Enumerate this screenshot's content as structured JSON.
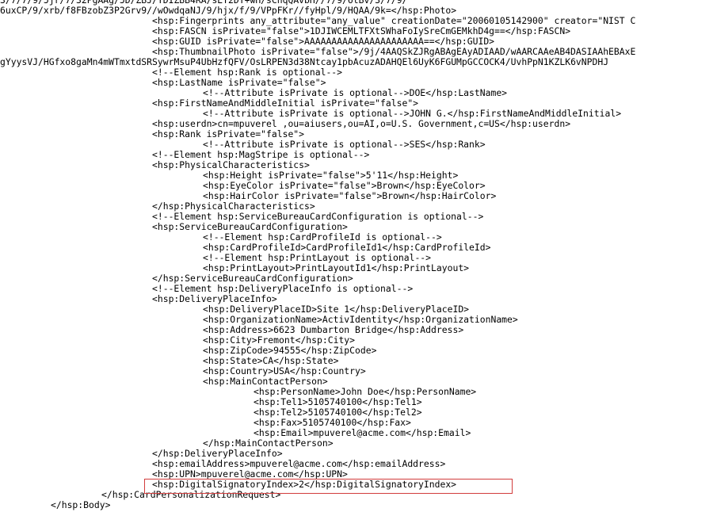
{
  "highlight_color": "#d23c3c",
  "lines": [
    {
      "indent": 0,
      "text": "3/7/7/9/5jr/7/32PgAAg/5D/ZBJ/YDIZBB4RA/sET2DT+wH/sChqQAvbH//7/9/6tBv/3/7/9/"
    },
    {
      "indent": 0,
      "text": "6uxCP/9/xrb/f8FBzobZ3P2Grv9//wOwdqaNJ/9/hjx/f/9/VPpFKr//fyHpl/9/HQAA/9k=</hsp:Photo>"
    },
    {
      "indent": 192,
      "text": "<hsp:Fingerprints any_attribute=\"any_value\" creationDate=\"20060105142900\" creator=\"NIST C"
    },
    {
      "indent": 192,
      "text": "<hsp:FASCN isPrivate=\"false\">1DJIWCEMLTFXtSWhaFoIySreCmGEMkhD4g==</hsp:FASCN>"
    },
    {
      "indent": 192,
      "text": "<hsp:GUID isPrivate=\"false\">AAAAAAAAAAAAAAAAAAAAAA==</hsp:GUID>"
    },
    {
      "indent": 192,
      "text": "<hsp:ThumbnailPhoto isPrivate=\"false\">/9j/4AAQSkZJRgABAgEAyADIAAD/wAARCAAeAB4DASIAAhEBAxE"
    },
    {
      "indent": 0,
      "text": "gYyysVJ/HGfxo8gaMn4mWTmxtdSRSywrMsuP4UbHzfQFV/OsLRPEN3d38Ntcay1pbAcuzADAHQEl6UyK6FGUMpGCCOCK4/UvhPpN1KZLK6vNPDHJ"
    },
    {
      "indent": 192,
      "text": "<!--Element hsp:Rank is optional-->"
    },
    {
      "indent": 192,
      "text": "<hsp:LastName isPrivate=\"false\">"
    },
    {
      "indent": 256,
      "text": "<!--Attribute isPrivate is optional-->DOE</hsp:LastName>"
    },
    {
      "indent": 192,
      "text": "<hsp:FirstNameAndMiddleInitial isPrivate=\"false\">"
    },
    {
      "indent": 256,
      "text": "<!--Attribute isPrivate is optional-->JOHN G.</hsp:FirstNameAndMiddleInitial>"
    },
    {
      "indent": 192,
      "text": "<hsp:userdn>cn=mpuverel ,ou=aiusers,ou=AI,o=U.S. Government,c=US</hsp:userdn>"
    },
    {
      "indent": 192,
      "text": "<hsp:Rank isPrivate=\"false\">"
    },
    {
      "indent": 256,
      "text": "<!--Attribute isPrivate is optional-->SES</hsp:Rank>"
    },
    {
      "indent": 192,
      "text": "<!--Element hsp:MagStripe is optional-->"
    },
    {
      "indent": 192,
      "text": "<hsp:PhysicalCharacteristics>"
    },
    {
      "indent": 256,
      "text": "<hsp:Height isPrivate=\"false\">5'11</hsp:Height>"
    },
    {
      "indent": 256,
      "text": "<hsp:EyeColor isPrivate=\"false\">Brown</hsp:EyeColor>"
    },
    {
      "indent": 256,
      "text": "<hsp:HairColor isPrivate=\"false\">Brown</hsp:HairColor>"
    },
    {
      "indent": 192,
      "text": "</hsp:PhysicalCharacteristics>"
    },
    {
      "indent": 192,
      "text": "<!--Element hsp:ServiceBureauCardConfiguration is optional-->"
    },
    {
      "indent": 192,
      "text": "<hsp:ServiceBureauCardConfiguration>"
    },
    {
      "indent": 256,
      "text": "<!--Element hsp:CardProfileId is optional-->"
    },
    {
      "indent": 256,
      "text": "<hsp:CardProfileId>CardProfileId1</hsp:CardProfileId>"
    },
    {
      "indent": 256,
      "text": "<!--Element hsp:PrintLayout is optional-->"
    },
    {
      "indent": 256,
      "text": "<hsp:PrintLayout>PrintLayoutId1</hsp:PrintLayout>"
    },
    {
      "indent": 192,
      "text": "</hsp:ServiceBureauCardConfiguration>"
    },
    {
      "indent": 192,
      "text": "<!--Element hsp:DeliveryPlaceInfo is optional-->"
    },
    {
      "indent": 192,
      "text": "<hsp:DeliveryPlaceInfo>"
    },
    {
      "indent": 256,
      "text": "<hsp:DeliveryPlaceID>Site 1</hsp:DeliveryPlaceID>"
    },
    {
      "indent": 256,
      "text": "<hsp:OrganizationName>ActivIdentity</hsp:OrganizationName>"
    },
    {
      "indent": 256,
      "text": "<hsp:Address>6623 Dumbarton Bridge</hsp:Address>"
    },
    {
      "indent": 256,
      "text": "<hsp:City>Fremont</hsp:City>"
    },
    {
      "indent": 256,
      "text": "<hsp:ZipCode>94555</hsp:ZipCode>"
    },
    {
      "indent": 256,
      "text": "<hsp:State>CA</hsp:State>"
    },
    {
      "indent": 256,
      "text": "<hsp:Country>USA</hsp:Country>"
    },
    {
      "indent": 256,
      "text": "<hsp:MainContactPerson>"
    },
    {
      "indent": 320,
      "text": "<hsp:PersonName>John Doe</hsp:PersonName>"
    },
    {
      "indent": 320,
      "text": "<hsp:Tel1>5105740100</hsp:Tel1>"
    },
    {
      "indent": 320,
      "text": "<hsp:Tel2>5105740100</hsp:Tel2>"
    },
    {
      "indent": 320,
      "text": "<hsp:Fax>5105740100</hsp:Fax>"
    },
    {
      "indent": 320,
      "text": "<hsp:Email>mpuverel@acme.com</hsp:Email>"
    },
    {
      "indent": 256,
      "text": "</hsp:MainContactPerson>"
    },
    {
      "indent": 192,
      "text": "</hsp:DeliveryPlaceInfo>"
    },
    {
      "indent": 192,
      "text": "<hsp:emailAddress>mpuverel@acme.com</hsp:emailAddress>"
    },
    {
      "indent": 192,
      "text": "<hsp:UPN>mpuverel@acme.com</hsp:UPN>"
    },
    {
      "indent": 192,
      "text": "<hsp:DigitalSignatoryIndex>2</hsp:DigitalSignatoryIndex>",
      "highlighted": true
    },
    {
      "indent": 128,
      "text": "</hsp:CardPersonalizationRequest>"
    },
    {
      "indent": 64,
      "text": "</hsp:Body>"
    }
  ]
}
